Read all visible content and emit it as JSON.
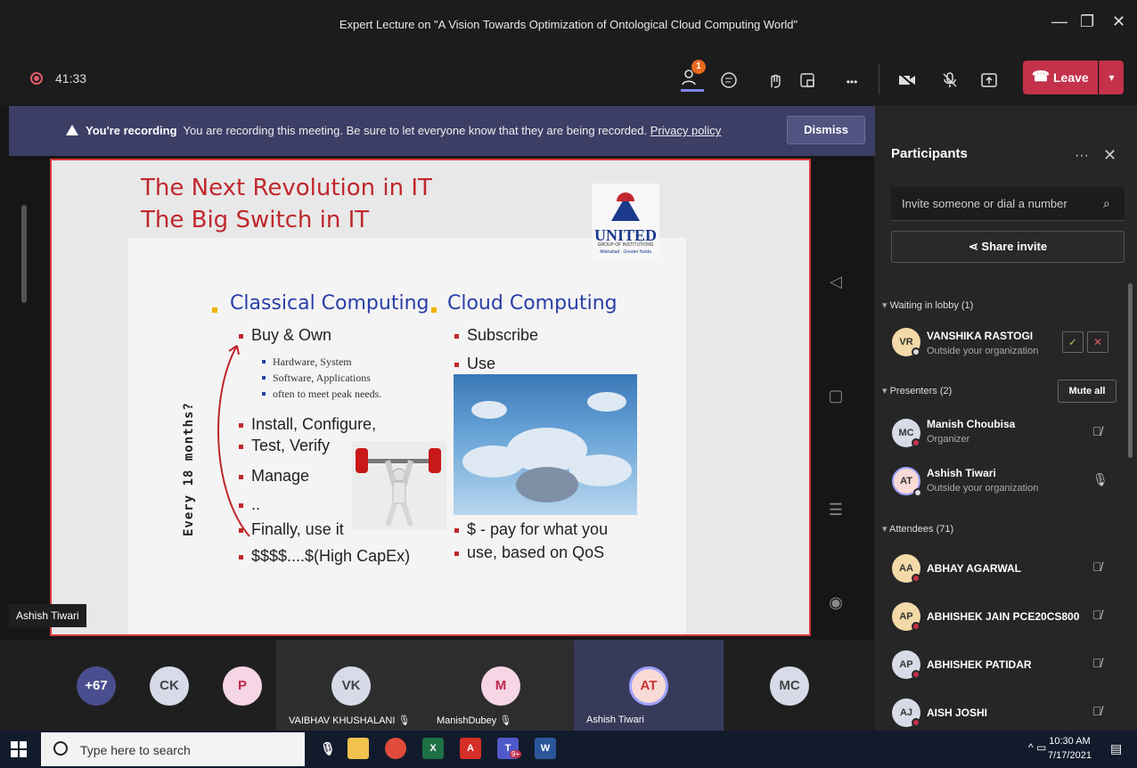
{
  "window": {
    "title": "Expert Lecture on \"A Vision Towards Optimization of Ontological Cloud Computing World\"",
    "min": "—",
    "restore": "❐",
    "close": "✕"
  },
  "toolbar": {
    "timer": "41:33",
    "participants_badge": "1",
    "leave_label": "Leave",
    "more": "•••"
  },
  "recording_banner": {
    "strong": "You're recording",
    "text": "You are recording this meeting. Be sure to let everyone know that they are being recorded.",
    "link": "Privacy policy",
    "dismiss": "Dismiss"
  },
  "slide": {
    "title1": "The Next Revolution in IT",
    "title2": "The Big Switch in IT",
    "logo_name": "UNITED",
    "logo_sub": "GROUP OF INSTITUTIONS",
    "logo_sub2": "Allahabad . Greater Noida",
    "left_head": "Classical Computing",
    "right_head": "Cloud Computing",
    "left_items": [
      "Buy & Own",
      "Install, Configure,",
      "Test, Verify",
      "Manage",
      "..",
      "Finally, use it",
      "$$$$....$(High CapEx)"
    ],
    "left_sub": [
      "Hardware, System",
      "Software, Applications",
      "often to meet peak needs."
    ],
    "right_items": [
      "Subscribe",
      "Use"
    ],
    "right_pay1": "$ - pay for what you",
    "right_pay2": "use, based on QoS",
    "vertical": "Every 18 months?",
    "presenter_label": "Ashish Tiwari"
  },
  "strip": {
    "more_count": "+67",
    "ck": "CK",
    "p": "P",
    "vk": "VK",
    "vk_name": "VAIBHAV KHUSHALANI",
    "m": "M",
    "m_name": "ManishDubey",
    "at": "AT",
    "at_name": "Ashish Tiwari",
    "mc": "MC"
  },
  "panel": {
    "title": "Participants",
    "invite_placeholder": "Invite someone or dial a number",
    "share_invite": "Share invite",
    "lobby_head": "Waiting in lobby (1)",
    "lobby": {
      "initials": "VR",
      "name": "VANSHIKA RASTOGI",
      "sub": "Outside your organization"
    },
    "presenters_head": "Presenters (2)",
    "mute_all": "Mute all",
    "presenters": [
      {
        "initials": "MC",
        "name": "Manish Choubisa",
        "sub": "Organizer"
      },
      {
        "initials": "AT",
        "name": "Ashish Tiwari",
        "sub": "Outside your organization"
      }
    ],
    "attendees_head": "Attendees (71)",
    "attendees": [
      {
        "initials": "AA",
        "name": "ABHAY AGARWAL"
      },
      {
        "initials": "AP",
        "name": "ABHISHEK JAIN PCE20CS800"
      },
      {
        "initials": "AP",
        "name": "ABHISHEK PATIDAR"
      },
      {
        "initials": "AJ",
        "name": "AISH JOSHI"
      }
    ]
  },
  "taskbar": {
    "search_placeholder": "Type here to search",
    "time": "10:30 AM",
    "date": "7/17/2021",
    "teams_badge": "9+"
  }
}
